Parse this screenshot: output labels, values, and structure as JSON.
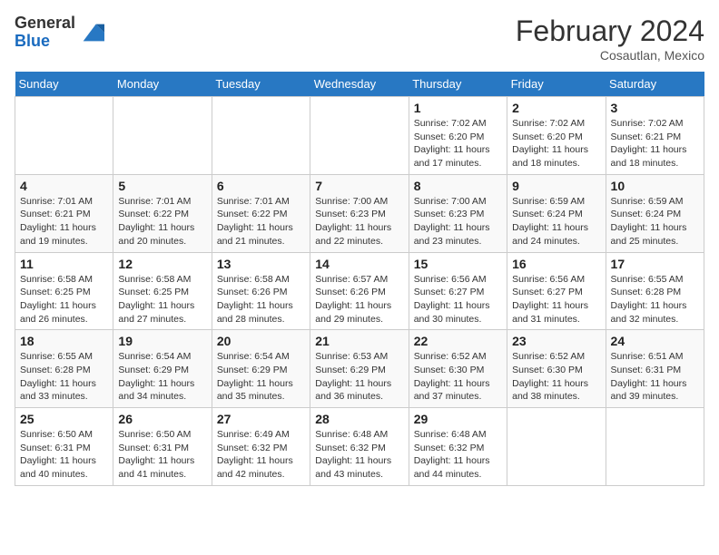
{
  "logo": {
    "general": "General",
    "blue": "Blue"
  },
  "header": {
    "month": "February 2024",
    "location": "Cosautlan, Mexico"
  },
  "weekdays": [
    "Sunday",
    "Monday",
    "Tuesday",
    "Wednesday",
    "Thursday",
    "Friday",
    "Saturday"
  ],
  "weeks": [
    [
      {
        "day": "",
        "info": ""
      },
      {
        "day": "",
        "info": ""
      },
      {
        "day": "",
        "info": ""
      },
      {
        "day": "",
        "info": ""
      },
      {
        "day": "1",
        "info": "Sunrise: 7:02 AM\nSunset: 6:20 PM\nDaylight: 11 hours and 17 minutes."
      },
      {
        "day": "2",
        "info": "Sunrise: 7:02 AM\nSunset: 6:20 PM\nDaylight: 11 hours and 18 minutes."
      },
      {
        "day": "3",
        "info": "Sunrise: 7:02 AM\nSunset: 6:21 PM\nDaylight: 11 hours and 18 minutes."
      }
    ],
    [
      {
        "day": "4",
        "info": "Sunrise: 7:01 AM\nSunset: 6:21 PM\nDaylight: 11 hours and 19 minutes."
      },
      {
        "day": "5",
        "info": "Sunrise: 7:01 AM\nSunset: 6:22 PM\nDaylight: 11 hours and 20 minutes."
      },
      {
        "day": "6",
        "info": "Sunrise: 7:01 AM\nSunset: 6:22 PM\nDaylight: 11 hours and 21 minutes."
      },
      {
        "day": "7",
        "info": "Sunrise: 7:00 AM\nSunset: 6:23 PM\nDaylight: 11 hours and 22 minutes."
      },
      {
        "day": "8",
        "info": "Sunrise: 7:00 AM\nSunset: 6:23 PM\nDaylight: 11 hours and 23 minutes."
      },
      {
        "day": "9",
        "info": "Sunrise: 6:59 AM\nSunset: 6:24 PM\nDaylight: 11 hours and 24 minutes."
      },
      {
        "day": "10",
        "info": "Sunrise: 6:59 AM\nSunset: 6:24 PM\nDaylight: 11 hours and 25 minutes."
      }
    ],
    [
      {
        "day": "11",
        "info": "Sunrise: 6:58 AM\nSunset: 6:25 PM\nDaylight: 11 hours and 26 minutes."
      },
      {
        "day": "12",
        "info": "Sunrise: 6:58 AM\nSunset: 6:25 PM\nDaylight: 11 hours and 27 minutes."
      },
      {
        "day": "13",
        "info": "Sunrise: 6:58 AM\nSunset: 6:26 PM\nDaylight: 11 hours and 28 minutes."
      },
      {
        "day": "14",
        "info": "Sunrise: 6:57 AM\nSunset: 6:26 PM\nDaylight: 11 hours and 29 minutes."
      },
      {
        "day": "15",
        "info": "Sunrise: 6:56 AM\nSunset: 6:27 PM\nDaylight: 11 hours and 30 minutes."
      },
      {
        "day": "16",
        "info": "Sunrise: 6:56 AM\nSunset: 6:27 PM\nDaylight: 11 hours and 31 minutes."
      },
      {
        "day": "17",
        "info": "Sunrise: 6:55 AM\nSunset: 6:28 PM\nDaylight: 11 hours and 32 minutes."
      }
    ],
    [
      {
        "day": "18",
        "info": "Sunrise: 6:55 AM\nSunset: 6:28 PM\nDaylight: 11 hours and 33 minutes."
      },
      {
        "day": "19",
        "info": "Sunrise: 6:54 AM\nSunset: 6:29 PM\nDaylight: 11 hours and 34 minutes."
      },
      {
        "day": "20",
        "info": "Sunrise: 6:54 AM\nSunset: 6:29 PM\nDaylight: 11 hours and 35 minutes."
      },
      {
        "day": "21",
        "info": "Sunrise: 6:53 AM\nSunset: 6:29 PM\nDaylight: 11 hours and 36 minutes."
      },
      {
        "day": "22",
        "info": "Sunrise: 6:52 AM\nSunset: 6:30 PM\nDaylight: 11 hours and 37 minutes."
      },
      {
        "day": "23",
        "info": "Sunrise: 6:52 AM\nSunset: 6:30 PM\nDaylight: 11 hours and 38 minutes."
      },
      {
        "day": "24",
        "info": "Sunrise: 6:51 AM\nSunset: 6:31 PM\nDaylight: 11 hours and 39 minutes."
      }
    ],
    [
      {
        "day": "25",
        "info": "Sunrise: 6:50 AM\nSunset: 6:31 PM\nDaylight: 11 hours and 40 minutes."
      },
      {
        "day": "26",
        "info": "Sunrise: 6:50 AM\nSunset: 6:31 PM\nDaylight: 11 hours and 41 minutes."
      },
      {
        "day": "27",
        "info": "Sunrise: 6:49 AM\nSunset: 6:32 PM\nDaylight: 11 hours and 42 minutes."
      },
      {
        "day": "28",
        "info": "Sunrise: 6:48 AM\nSunset: 6:32 PM\nDaylight: 11 hours and 43 minutes."
      },
      {
        "day": "29",
        "info": "Sunrise: 6:48 AM\nSunset: 6:32 PM\nDaylight: 11 hours and 44 minutes."
      },
      {
        "day": "",
        "info": ""
      },
      {
        "day": "",
        "info": ""
      }
    ]
  ]
}
